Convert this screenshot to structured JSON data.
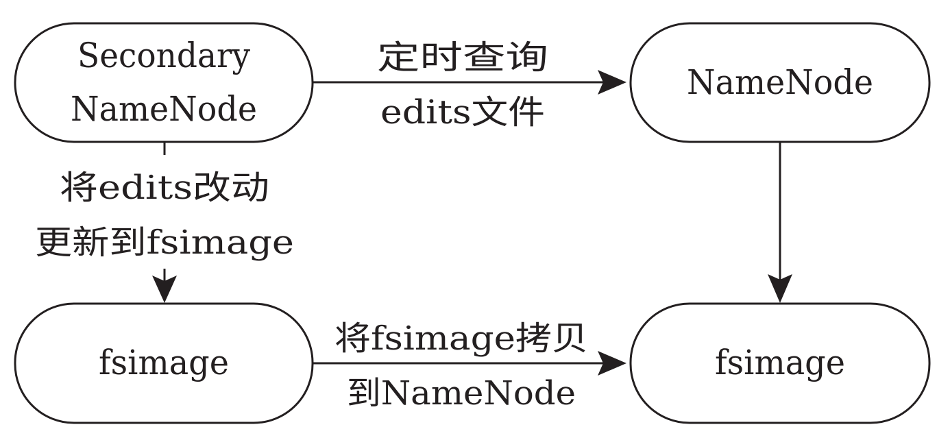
{
  "nodes": {
    "secondary_namenode": {
      "line1": "Secondary",
      "line2": "NameNode"
    },
    "namenode": {
      "label": "NameNode"
    },
    "fsimage_left": {
      "label": "fsimage"
    },
    "fsimage_right": {
      "label": "fsimage"
    }
  },
  "edges": {
    "query_edits": {
      "line1": "定时查询",
      "line2": "edits文件"
    },
    "update_fsimage": {
      "line1": "将edits改动",
      "line2": "更新到fsimage"
    },
    "copy_fsimage": {
      "line1": "将fsimage拷贝",
      "line2": "到NameNode"
    }
  },
  "colors": {
    "stroke": "#231f20",
    "background": "#ffffff"
  }
}
